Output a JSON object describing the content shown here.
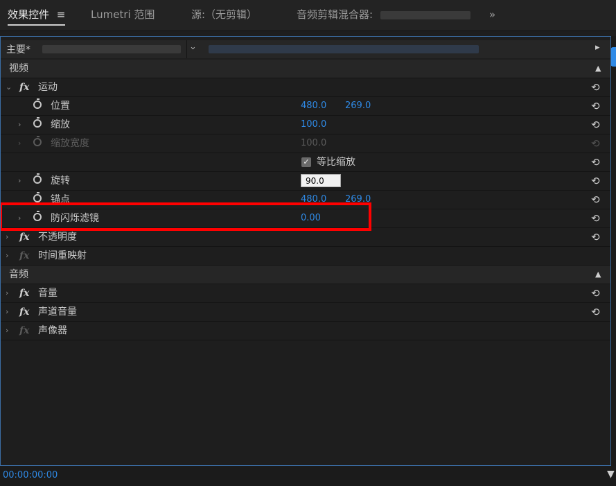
{
  "tabs": [
    {
      "label": "效果控件",
      "menu_icon": "≡",
      "active": true
    },
    {
      "label": "Lumetri 范围"
    },
    {
      "label": "源:（无剪辑）"
    },
    {
      "label": "音频剪辑混合器:"
    }
  ],
  "tabs_more": "»",
  "source_bar": {
    "master_label": "主要*",
    "chevron": "⌄",
    "play": "▸"
  },
  "sections": {
    "video": "视频",
    "audio": "音频"
  },
  "effects": {
    "motion": "运动",
    "opacity": "不透明度",
    "time_remap": "时间重映射",
    "volume": "音量",
    "channel_volume": "声道音量",
    "panner": "声像器"
  },
  "params": {
    "position": {
      "label": "位置",
      "x": "480.0",
      "y": "269.0"
    },
    "scale": {
      "label": "缩放",
      "value": "100.0"
    },
    "scale_width": {
      "label": "缩放宽度",
      "value": "100.0"
    },
    "uniform_scale": {
      "label": "等比缩放"
    },
    "rotation": {
      "label": "旋转",
      "value": "90.0"
    },
    "anchor": {
      "label": "锚点",
      "x": "480.0",
      "y": "269.0"
    },
    "anti_flicker": {
      "label": "防闪烁滤镜",
      "value": "0.00"
    }
  },
  "icons": {
    "reset": "⟲",
    "collapse": "▲",
    "expand_right": "›",
    "expand_down": "⌄",
    "fx": "fx",
    "check": "✓",
    "funnel": "▼"
  },
  "footer": {
    "timecode": "00:00:00:00"
  },
  "colors": {
    "value_blue": "#2f8ae6",
    "highlight_red": "#ff0000",
    "panel_border": "#3b6ea5"
  }
}
